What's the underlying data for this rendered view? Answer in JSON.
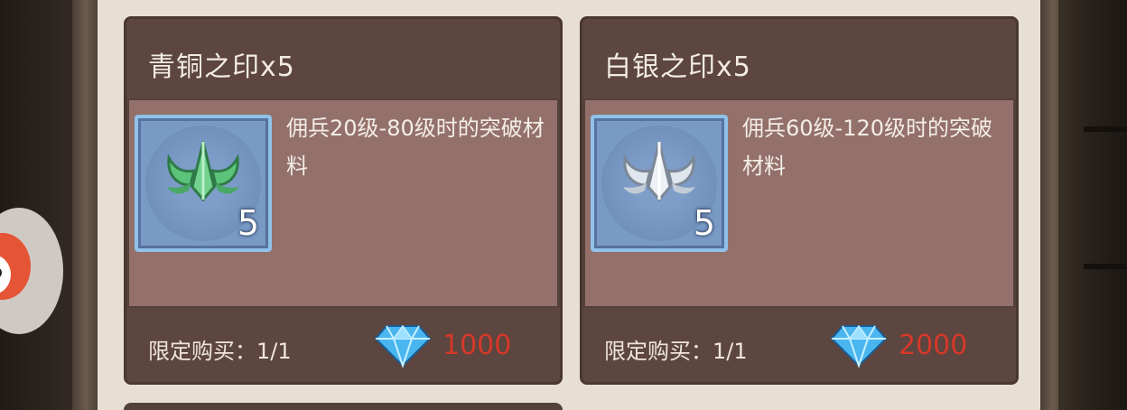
{
  "cards": [
    {
      "title": "青铜之印x5",
      "item_icon": "bronze-seal-icon",
      "item_color": "#5cc47a",
      "item_count": "5",
      "description": "佣兵20级-80级时的突破材料",
      "limit_label": "限定购买：",
      "limit_value": "1/1",
      "currency_icon": "diamond-icon",
      "price": "1000"
    },
    {
      "title": "白银之印x5",
      "item_icon": "silver-seal-icon",
      "item_color": "#dfe6ee",
      "item_count": "5",
      "description": "佣兵60级-120级时的突破材料",
      "limit_label": "限定购买：",
      "limit_value": "1/1",
      "currency_icon": "diamond-icon",
      "price": "2000"
    }
  ],
  "colors": {
    "card_bg": "#54413a",
    "card_body": "#93716a",
    "price_red": "#d6382a",
    "item_frame": "#8fc1ea"
  }
}
